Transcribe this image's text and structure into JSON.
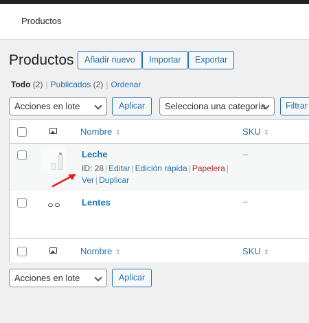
{
  "header": {
    "title": "Productos"
  },
  "page": {
    "title": "Productos",
    "buttons": {
      "add_new": "Añadir nuevo",
      "import": "Importar",
      "export": "Exportar"
    }
  },
  "views": {
    "all_label": "Todo",
    "all_count": "(2)",
    "published_label": "Publicados",
    "published_count": "(2)",
    "sort_label": "Ordenar",
    "separator": "|"
  },
  "bulk_top": {
    "selected": "Acciones en lote",
    "apply": "Aplicar"
  },
  "category_filter": {
    "selected": "Selecciona una categoría",
    "filter_button": "Filtrar"
  },
  "table": {
    "columns": {
      "name": "Nombre",
      "sku": "SKU",
      "sort_glyph": "⇕"
    },
    "rows": [
      {
        "name": "Leche",
        "sku": "–",
        "id_text": "ID: 28",
        "actions": {
          "edit": "Editar",
          "quick_edit": "Edición rápida",
          "trash": "Papelera",
          "view": "Ver",
          "duplicate": "Duplicar"
        }
      },
      {
        "name": "Lentes",
        "sku": "–"
      }
    ]
  },
  "bulk_bottom": {
    "selected": "Acciones en lote",
    "apply": "Aplicar"
  },
  "colors": {
    "accent": "#2271b1",
    "danger": "#b32d2e",
    "annotation_arrow": "#e11d1d"
  },
  "icons": {
    "column_image": "image-icon",
    "dropdown": "chevron-down-icon",
    "annotation": "red-arrow-icon"
  }
}
